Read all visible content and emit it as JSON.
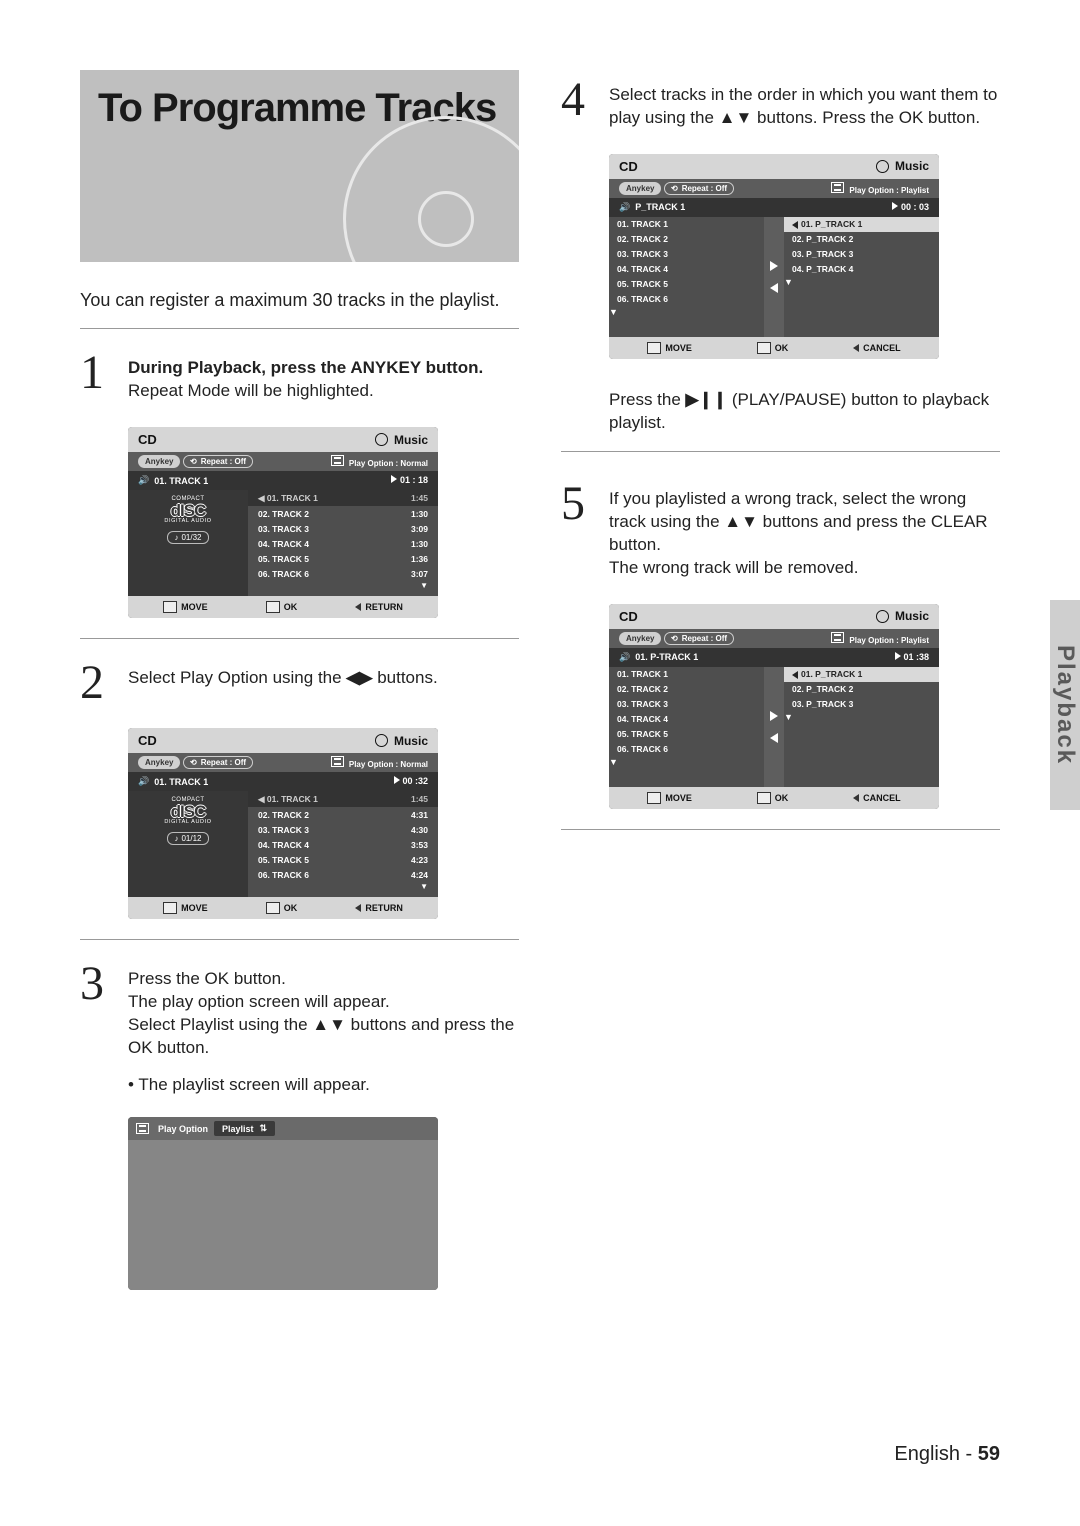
{
  "title": "To Programme Tracks",
  "intro": "You can register a maximum 30 tracks in the playlist.",
  "steps": {
    "s1": {
      "num": "1",
      "bold": "During Playback, press the ANYKEY button.",
      "text": "Repeat Mode will be highlighted."
    },
    "s2": {
      "num": "2",
      "text_a": "Select Play Option using the ",
      "text_b": " buttons."
    },
    "s3": {
      "num": "3",
      "line1": "Press the OK button.",
      "line2": "The play option screen will appear.",
      "line3a": "Select Playlist using the ",
      "line3b": "buttons and press the OK button.",
      "bullet": "• The playlist screen will appear."
    },
    "s4": {
      "num": "4",
      "line_a": "Select tracks in the order in which you want them to play using the ",
      "line_b": " buttons. Press the OK button."
    },
    "s4b": {
      "line_a": "Press the ",
      "line_b": " (PLAY/PAUSE) button to playback playlist."
    },
    "s5": {
      "num": "5",
      "line_a": "If you playlisted a wrong track, select the wrong track using the ",
      "line_b": "buttons and press the CLEAR button.",
      "line2": "The wrong track will be removed."
    }
  },
  "glyph": {
    "updown": "▲▼",
    "lr": "◀▶",
    "playpause": "▶❙❙"
  },
  "osd": {
    "common": {
      "cd": "CD",
      "music": "Music",
      "anykey": "Anykey",
      "repeat_off": "Repeat : Off",
      "play_opt_normal": "Play Option : Normal",
      "play_opt_playlist": "Play Option : Playlist",
      "move": "MOVE",
      "ok": "OK",
      "return": "RETURN",
      "cancel": "CANCEL",
      "compact": "COMPACT",
      "disc": "dISC",
      "digital_audio": "DIGITAL AUDIO"
    },
    "a": {
      "current": "01. TRACK 1",
      "time": "01 : 18",
      "count": "01/32",
      "tracks": [
        {
          "n": "01. TRACK 1",
          "t": "1:45",
          "hl": true
        },
        {
          "n": "02. TRACK 2",
          "t": "1:30"
        },
        {
          "n": "03. TRACK 3",
          "t": "3:09"
        },
        {
          "n": "04. TRACK 4",
          "t": "1:30"
        },
        {
          "n": "05. TRACK 5",
          "t": "1:36"
        },
        {
          "n": "06. TRACK 6",
          "t": "3:07"
        }
      ]
    },
    "b": {
      "current": "01. TRACK 1",
      "time": "00 :32",
      "count": "01/12",
      "tracks": [
        {
          "n": "01. TRACK 1",
          "t": "1:45",
          "hl": true
        },
        {
          "n": "02. TRACK 2",
          "t": "4:31"
        },
        {
          "n": "03. TRACK 3",
          "t": "4:30"
        },
        {
          "n": "04. TRACK 4",
          "t": "3:53"
        },
        {
          "n": "05. TRACK 5",
          "t": "4:23"
        },
        {
          "n": "06. TRACK 6",
          "t": "4:24"
        }
      ]
    },
    "c": {
      "label": "Play Option",
      "value": "Playlist"
    },
    "d": {
      "current": "P_TRACK 1",
      "time": "00 : 03",
      "left": [
        "01. TRACK 1",
        "02. TRACK 2",
        "03. TRACK 3",
        "04. TRACK 4",
        "05. TRACK 5",
        "06. TRACK 6"
      ],
      "right": [
        {
          "n": "01. P_TRACK 1",
          "hl": true
        },
        {
          "n": "02. P_TRACK 2"
        },
        {
          "n": "03. P_TRACK 3"
        },
        {
          "n": "04. P_TRACK 4"
        }
      ]
    },
    "e": {
      "current": "01. P-TRACK 1",
      "time": "01 :38",
      "left": [
        "01. TRACK 1",
        "02. TRACK 2",
        "03. TRACK 3",
        "04. TRACK 4",
        "05. TRACK 5",
        "06. TRACK 6"
      ],
      "right": [
        {
          "n": "01. P_TRACK 1",
          "hl": true
        },
        {
          "n": "02. P_TRACK 2"
        },
        {
          "n": "03. P_TRACK 3"
        }
      ]
    }
  },
  "sidetab": "Playback",
  "footer": {
    "lang": "English",
    "sep": " - ",
    "page": "59"
  }
}
